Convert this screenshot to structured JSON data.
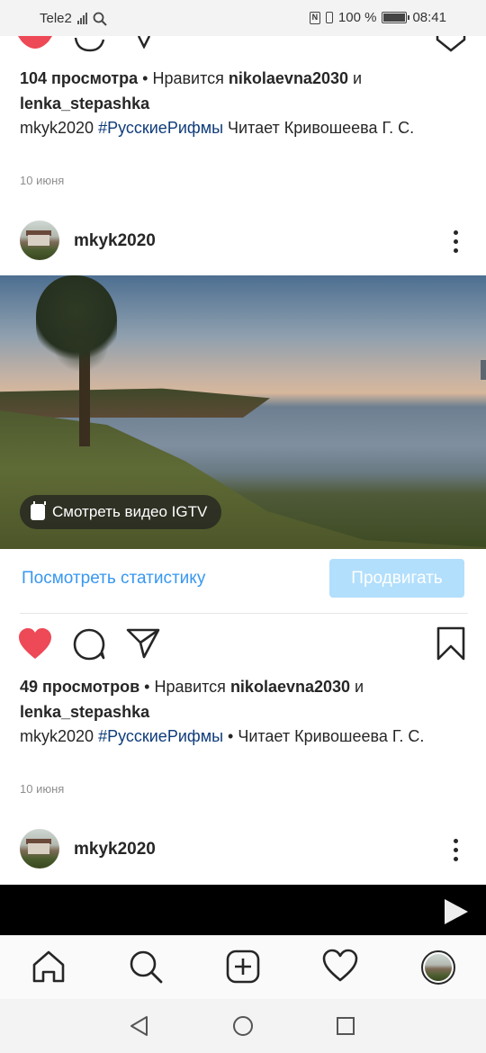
{
  "status_bar": {
    "carrier": "Tele2",
    "battery_text": "100 %",
    "battery_level": 1.0,
    "time": "08:41"
  },
  "post1": {
    "views": "104 просмотра",
    "likes_prefix": "Нравится",
    "liker": "nikolaevna2030",
    "and": "и",
    "liker2": "lenka_stepashka",
    "caption_user": "mkyk2020",
    "hashtag": "#РусскиеРифмы",
    "caption_text": "Читает Кривошеева Г. С.",
    "date": "10 июня"
  },
  "post2": {
    "username": "mkyk2020",
    "igtv_label": "Смотреть видео IGTV",
    "stats_link": "Посмотреть статистику",
    "promote_button": "Продвигать",
    "views": "49 просмотров",
    "likes_prefix": "Нравится",
    "liker": "nikolaevna2030",
    "and": "и",
    "liker2": "lenka_stepashka",
    "caption_user": "mkyk2020",
    "hashtag": "#РусскиеРифмы",
    "caption_text": "Читает Кривошеева Г. С.",
    "date": "10 июня"
  },
  "post3": {
    "username": "mkyk2020"
  },
  "colors": {
    "like_red": "#ed4956",
    "link_blue": "#3897f0",
    "promote_disabled": "#b2dffc",
    "hashtag": "#0f3c7a"
  },
  "icons": [
    "heart-icon",
    "comment-icon",
    "share-icon",
    "bookmark-icon",
    "home-icon",
    "search-icon",
    "add-icon",
    "activity-heart-icon",
    "back-icon",
    "home-circle-icon",
    "recents-icon",
    "play-icon",
    "igtv-icon",
    "more-icon"
  ]
}
